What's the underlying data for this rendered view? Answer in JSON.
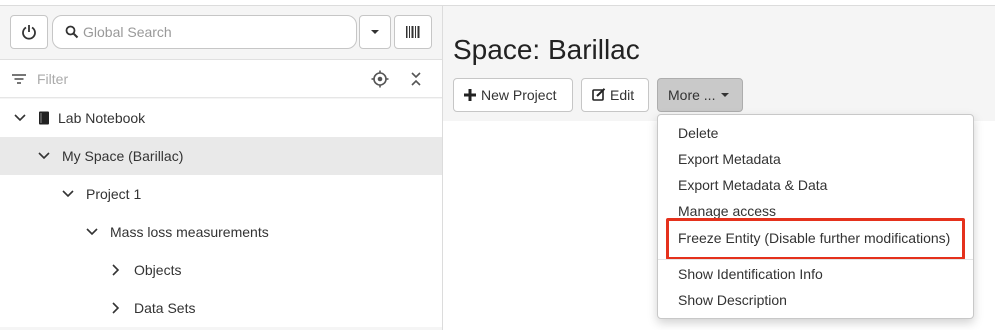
{
  "search": {
    "placeholder": "Global Search"
  },
  "filter": {
    "placeholder": "Filter"
  },
  "tree": [
    {
      "label": "Lab Notebook",
      "icon": "notebook-icon",
      "level": 0
    },
    {
      "label": "My Space (Barillac)",
      "level": 1,
      "selected": true
    },
    {
      "label": "Project 1",
      "level": 2
    },
    {
      "label": "Mass loss measurements",
      "level": 3
    },
    {
      "label": "Objects",
      "level": 4,
      "collapsed": true
    },
    {
      "label": "Data Sets",
      "level": 4,
      "collapsed": true
    }
  ],
  "main": {
    "title": "Space: Barillac",
    "buttons": {
      "new_project": "New Project",
      "edit": "Edit",
      "more": "More ..."
    }
  },
  "menu": {
    "items": [
      "Delete",
      "Export Metadata",
      "Export Metadata & Data",
      "Manage access",
      "Freeze Entity (Disable further modifications)",
      "Show Identification Info",
      "Show Description"
    ],
    "highlight_color": "#e5311c"
  }
}
